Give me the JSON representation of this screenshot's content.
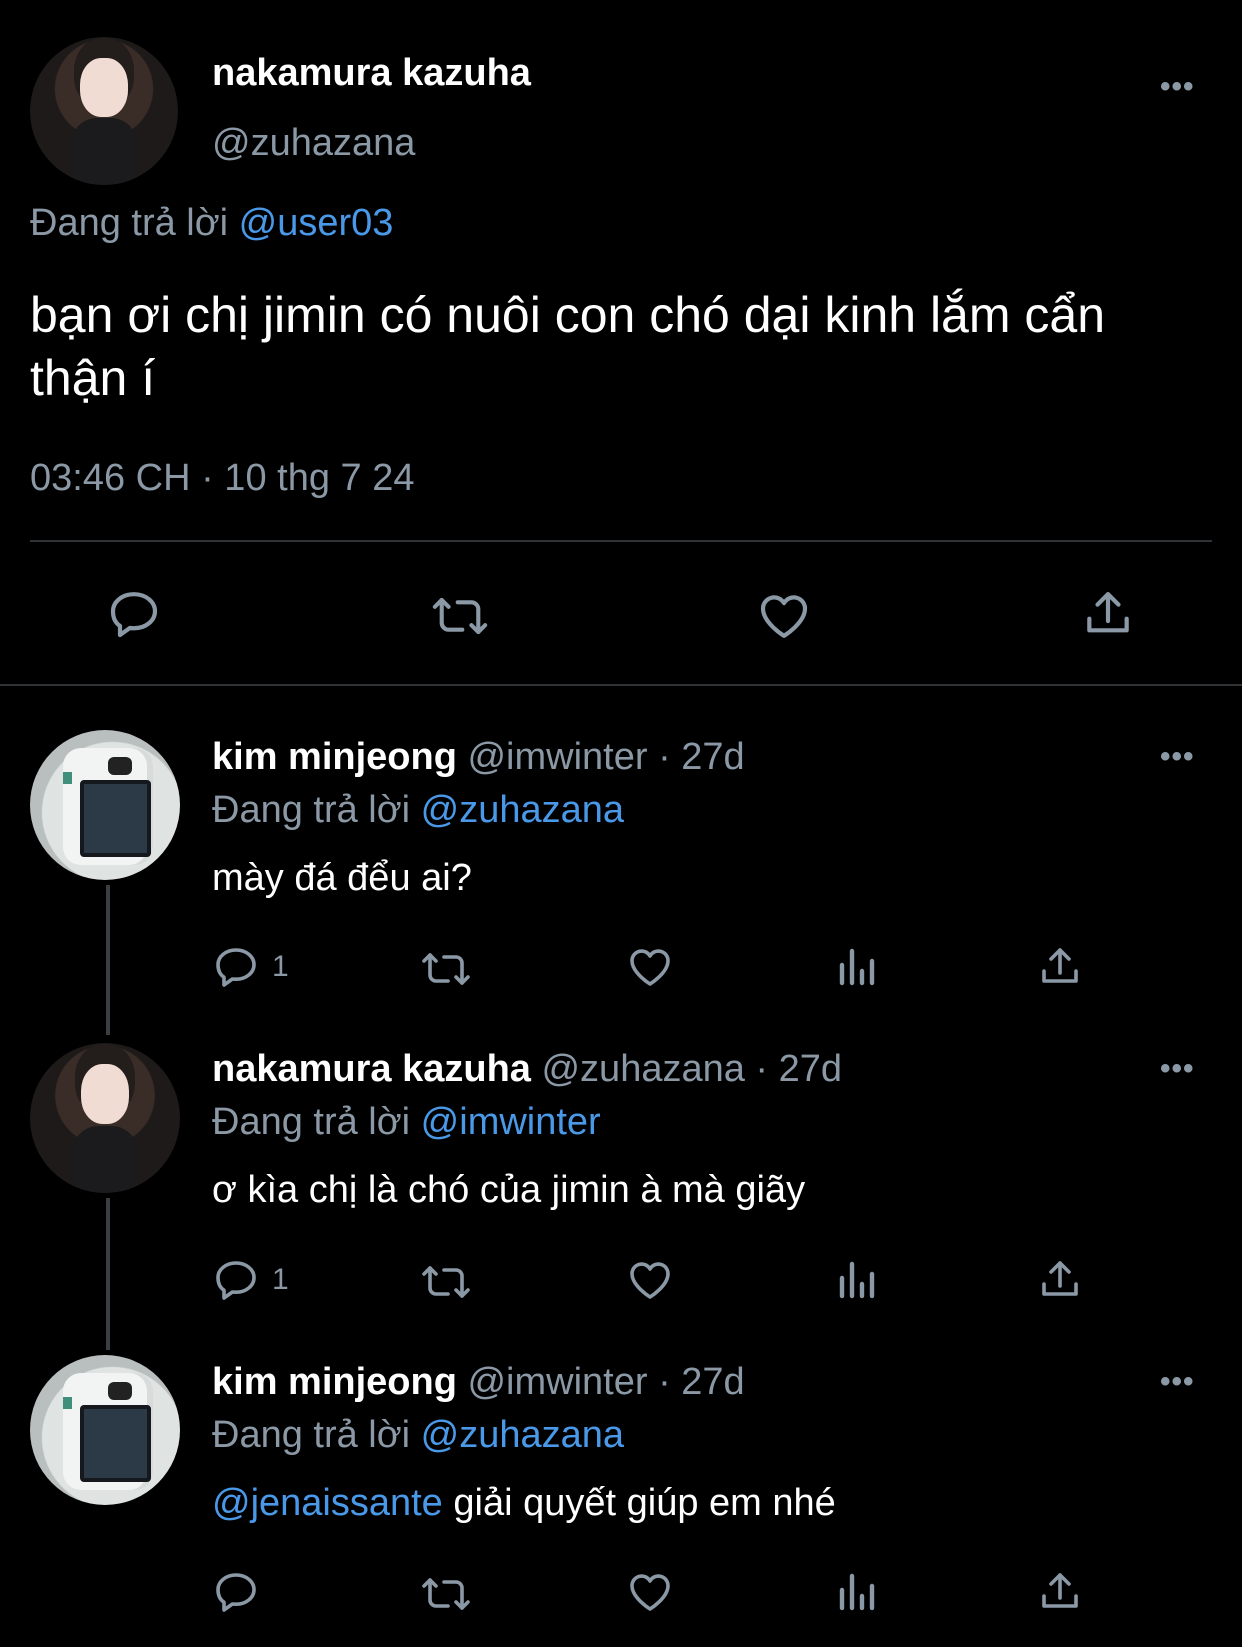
{
  "main": {
    "name": "nakamura kazuha",
    "handle": "@zuhazana",
    "replying_prefix": "Đang trả lời",
    "replying_to": "@user03",
    "text": "bạn ơi chị jimin có nuôi con chó dại kinh lắm cẩn thận í",
    "timestamp": "03:46 CH · 10 thg 7 24"
  },
  "more_label": "•••",
  "replies": [
    {
      "name": "kim minjeong",
      "handle": "@imwinter · 27d",
      "replying_prefix": "Đang trả lời",
      "replying_to": "@zuhazana",
      "text": "mày đá đểu ai?",
      "reply_count": "1"
    },
    {
      "name": "nakamura kazuha",
      "handle": "@zuhazana · 27d",
      "replying_prefix": "Đang trả lời",
      "replying_to": "@imwinter",
      "text": "ơ kìa chị là chó của jimin à mà giãy",
      "reply_count": "1"
    },
    {
      "name": "kim minjeong",
      "handle": "@imwinter · 27d",
      "replying_prefix": "Đang trả lời",
      "replying_to": "@zuhazana",
      "text_mention": "@jenaissante",
      "text": " giải quyết giúp em nhé",
      "reply_count": ""
    }
  ],
  "colors": {
    "background": "#000000",
    "secondary": "#8b98a5",
    "link": "#4a99e9"
  },
  "icons": [
    "reply-icon",
    "retweet-icon",
    "like-icon",
    "views-icon",
    "share-icon",
    "more-icon"
  ]
}
